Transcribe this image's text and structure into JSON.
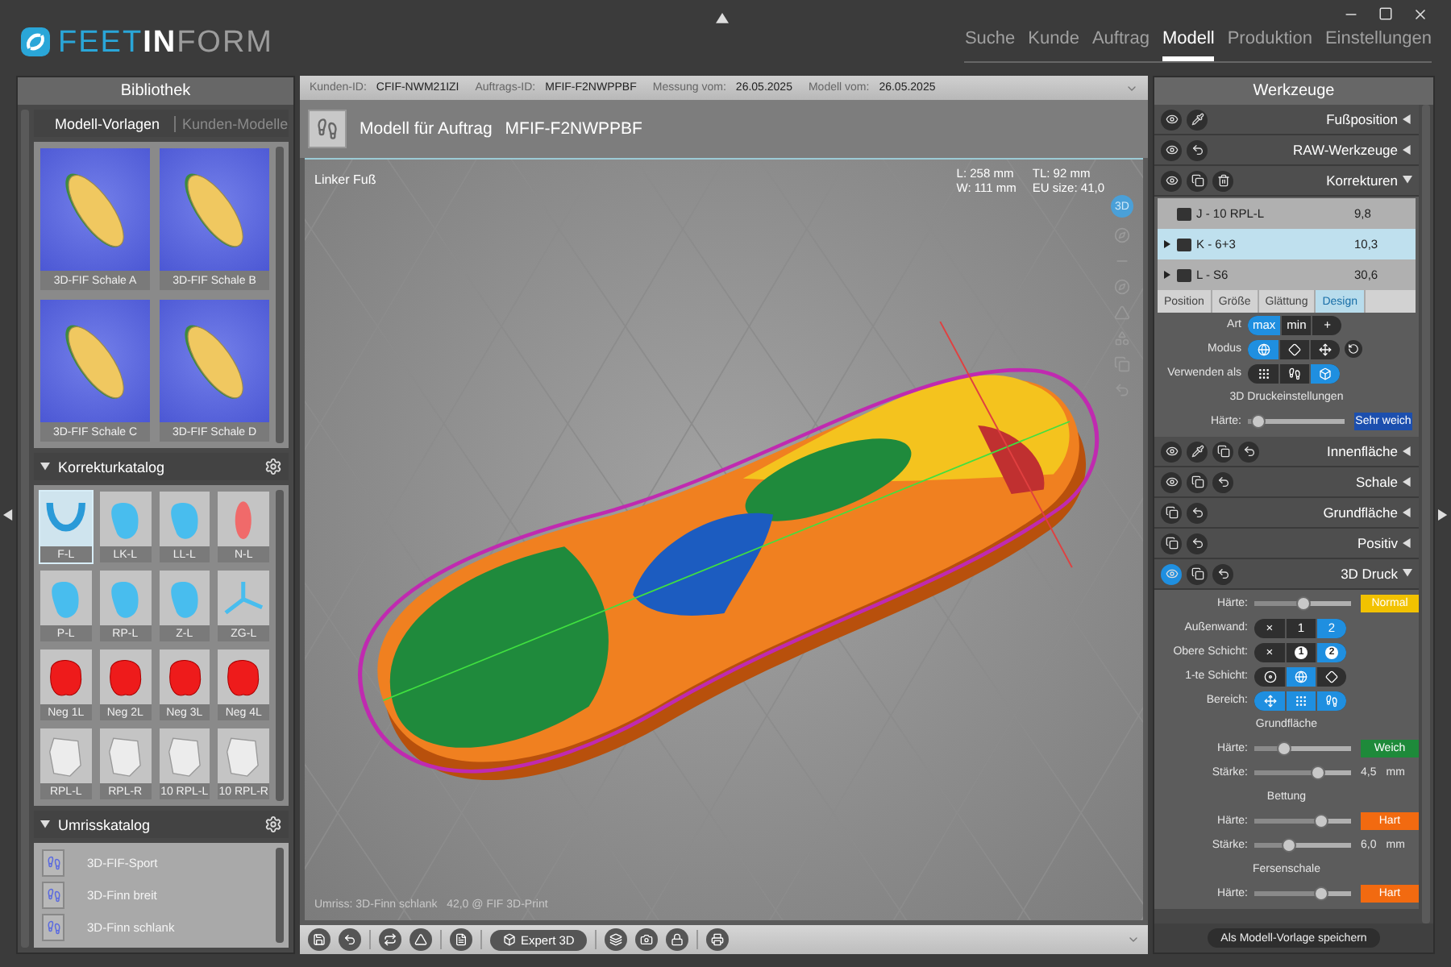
{
  "logo": [
    "FEET",
    "IN",
    "FORM"
  ],
  "nav": [
    {
      "label": "Suche",
      "selected": false
    },
    {
      "label": "Kunde",
      "selected": false
    },
    {
      "label": "Auftrag",
      "selected": false
    },
    {
      "label": "Modell",
      "selected": true
    },
    {
      "label": "Produktion",
      "selected": false
    },
    {
      "label": "Einstellungen",
      "selected": false
    }
  ],
  "library": {
    "title": "Bibliothek",
    "templates": {
      "tabs": [
        {
          "label": "Modell-Vorlagen",
          "selected": true
        },
        {
          "label": "Kunden-Modelle",
          "selected": false
        }
      ],
      "items": [
        "3D-FIF Schale A",
        "3D-FIF Schale B",
        "3D-FIF Schale C",
        "3D-FIF Schale D"
      ]
    },
    "corrections": {
      "title": "Korrekturkatalog",
      "items": [
        {
          "label": "F-L",
          "kind": "wedge",
          "selected": true
        },
        {
          "label": "LK-L",
          "kind": "pad",
          "selected": false
        },
        {
          "label": "LL-L",
          "kind": "pad",
          "selected": false
        },
        {
          "label": "N-L",
          "kind": "spot",
          "selected": false
        },
        {
          "label": "P-L",
          "kind": "pad",
          "selected": false
        },
        {
          "label": "RP-L",
          "kind": "pad",
          "selected": false
        },
        {
          "label": "Z-L",
          "kind": "pad",
          "selected": false
        },
        {
          "label": "ZG-L",
          "kind": "spread",
          "selected": false
        },
        {
          "label": "Neg 1L",
          "kind": "negative",
          "selected": false
        },
        {
          "label": "Neg 2L",
          "kind": "negative",
          "selected": false
        },
        {
          "label": "Neg 3L",
          "kind": "negative",
          "selected": false
        },
        {
          "label": "Neg 4L",
          "kind": "negative",
          "selected": false
        },
        {
          "label": "RPL-L",
          "kind": "cushion",
          "selected": false
        },
        {
          "label": "RPL-R",
          "kind": "cushion",
          "selected": false
        },
        {
          "label": "10 RPL-L",
          "kind": "cushion",
          "selected": false
        },
        {
          "label": "10 RPL-R",
          "kind": "cushion",
          "selected": false
        }
      ]
    },
    "outlines": {
      "title": "Umrisskatalog",
      "items": [
        "3D-FIF-Sport",
        "3D-Finn breit",
        "3D-Finn schlank"
      ]
    }
  },
  "info_bar": [
    {
      "label": "Kunden-ID:",
      "value": "CFIF-NWM21IZI"
    },
    {
      "label": "Auftrags-ID:",
      "value": "MFIF-F2NWPPBF"
    },
    {
      "label": "Messung vom:",
      "value": "26.05.2025"
    },
    {
      "label": "Modell vom:",
      "value": "26.05.2025"
    }
  ],
  "model": {
    "title": "Modell für Auftrag",
    "order": "MFIF-F2NWPPBF",
    "side": "Linker Fuß",
    "measures": [
      "L: 258 mm",
      "TL: 92 mm",
      "W: 111 mm",
      "EU size: 41,0"
    ],
    "view_mode": "3D",
    "footer": "Umriss: 3D-Finn schlank   42,0 @ FIF 3D-Print"
  },
  "toolbar": {
    "expert_button": "Expert 3D"
  },
  "tools": {
    "title": "Werkzeuge",
    "sections": [
      {
        "title": "Fußposition",
        "expanded": false,
        "highlighted": false
      },
      {
        "title": "RAW-Werkzeuge",
        "expanded": false,
        "highlighted": false
      },
      {
        "title": "Korrekturen",
        "expanded": true,
        "highlighted": false,
        "list": [
          {
            "name": "J - 10 RPL-L",
            "value": "9,8",
            "expandable": false,
            "selected": false
          },
          {
            "name": "K - 6+3",
            "value": "10,3",
            "expandable": true,
            "selected": true
          },
          {
            "name": "L - S6",
            "value": "30,6",
            "expandable": true,
            "selected": false
          }
        ],
        "tabs": [
          {
            "label": "Position",
            "selected": false
          },
          {
            "label": "Größe",
            "selected": false
          },
          {
            "label": "Glättung",
            "selected": false
          },
          {
            "label": "Design",
            "selected": true
          }
        ],
        "rows": [
          {
            "kind": "segments",
            "label": "Art",
            "options": [
              {
                "label": "max",
                "selected": true
              },
              {
                "label": "min",
                "selected": false
              },
              {
                "label": "+",
                "selected": false
              }
            ]
          },
          {
            "kind": "segments",
            "label": "Modus",
            "has_action": true,
            "options": [
              {
                "selected": true
              },
              {
                "selected": false
              },
              {
                "selected": false
              }
            ]
          },
          {
            "kind": "segments",
            "label": "Verwenden als",
            "options": [
              {
                "selected": false
              },
              {
                "selected": false
              },
              {
                "selected": true
              }
            ]
          },
          {
            "kind": "heading",
            "label": "3D Druckeinstellungen"
          },
          {
            "kind": "slider",
            "label": "Härte:",
            "level": 0.04,
            "badge": {
              "label": "Sehr weich",
              "color": "#1c4fae"
            }
          }
        ]
      },
      {
        "title": "Innenfläche",
        "expanded": false,
        "highlighted": false
      },
      {
        "title": "Schale",
        "expanded": false,
        "highlighted": false
      },
      {
        "title": "Grundfläche",
        "expanded": false
      },
      {
        "title": "Positiv",
        "expanded": false
      },
      {
        "title": "3D Druck",
        "expanded": true,
        "highlighted": true,
        "rows": [
          {
            "kind": "slider",
            "label": "Härte:",
            "level": 0.5,
            "badge": {
              "label": "Normal",
              "color": "#f2c200"
            }
          },
          {
            "kind": "segments",
            "label": "Außenwand:",
            "options": [
              {
                "label": "×",
                "selected": false
              },
              {
                "label": "1",
                "selected": false
              },
              {
                "label": "2",
                "selected": true
              }
            ]
          },
          {
            "kind": "segments",
            "label": "Obere Schicht:",
            "options": [
              {
                "label": "×",
                "selected": false
              },
              {
                "label": "1",
                "circled": true,
                "selected": false
              },
              {
                "label": "2",
                "circled": true,
                "selected": true
              }
            ]
          },
          {
            "kind": "segments",
            "label": "1-te Schicht:",
            "options": [
              {
                "selected": false
              },
              {
                "selected": true
              },
              {
                "selected": false
              }
            ]
          },
          {
            "kind": "segments",
            "label": "Bereich:",
            "options": [
              {
                "selected": true
              },
              {
                "selected": true
              },
              {
                "selected": true
              }
            ]
          },
          {
            "kind": "heading",
            "label": "Grundfläche"
          },
          {
            "kind": "slider",
            "label": "Härte:",
            "level": 0.28,
            "badge": {
              "label": "Weich",
              "color": "#1e8a3a"
            }
          },
          {
            "kind": "slider",
            "label": "Stärke:",
            "level": 0.68,
            "value": "4,5",
            "unit": "mm"
          },
          {
            "kind": "heading",
            "label": "Bettung"
          },
          {
            "kind": "slider",
            "label": "Härte:",
            "level": 0.72,
            "badge": {
              "label": "Hart",
              "color": "#f26a10"
            }
          },
          {
            "kind": "slider",
            "label": "Stärke:",
            "level": 0.33,
            "value": "6,0",
            "unit": "mm"
          },
          {
            "kind": "heading",
            "label": "Fersenschale"
          },
          {
            "kind": "slider",
            "label": "Härte:",
            "level": 0.72,
            "badge": {
              "label": "Hart",
              "color": "#f26a10"
            }
          }
        ]
      }
    ],
    "save_button": "Als Modell-Vorlage speichern"
  }
}
